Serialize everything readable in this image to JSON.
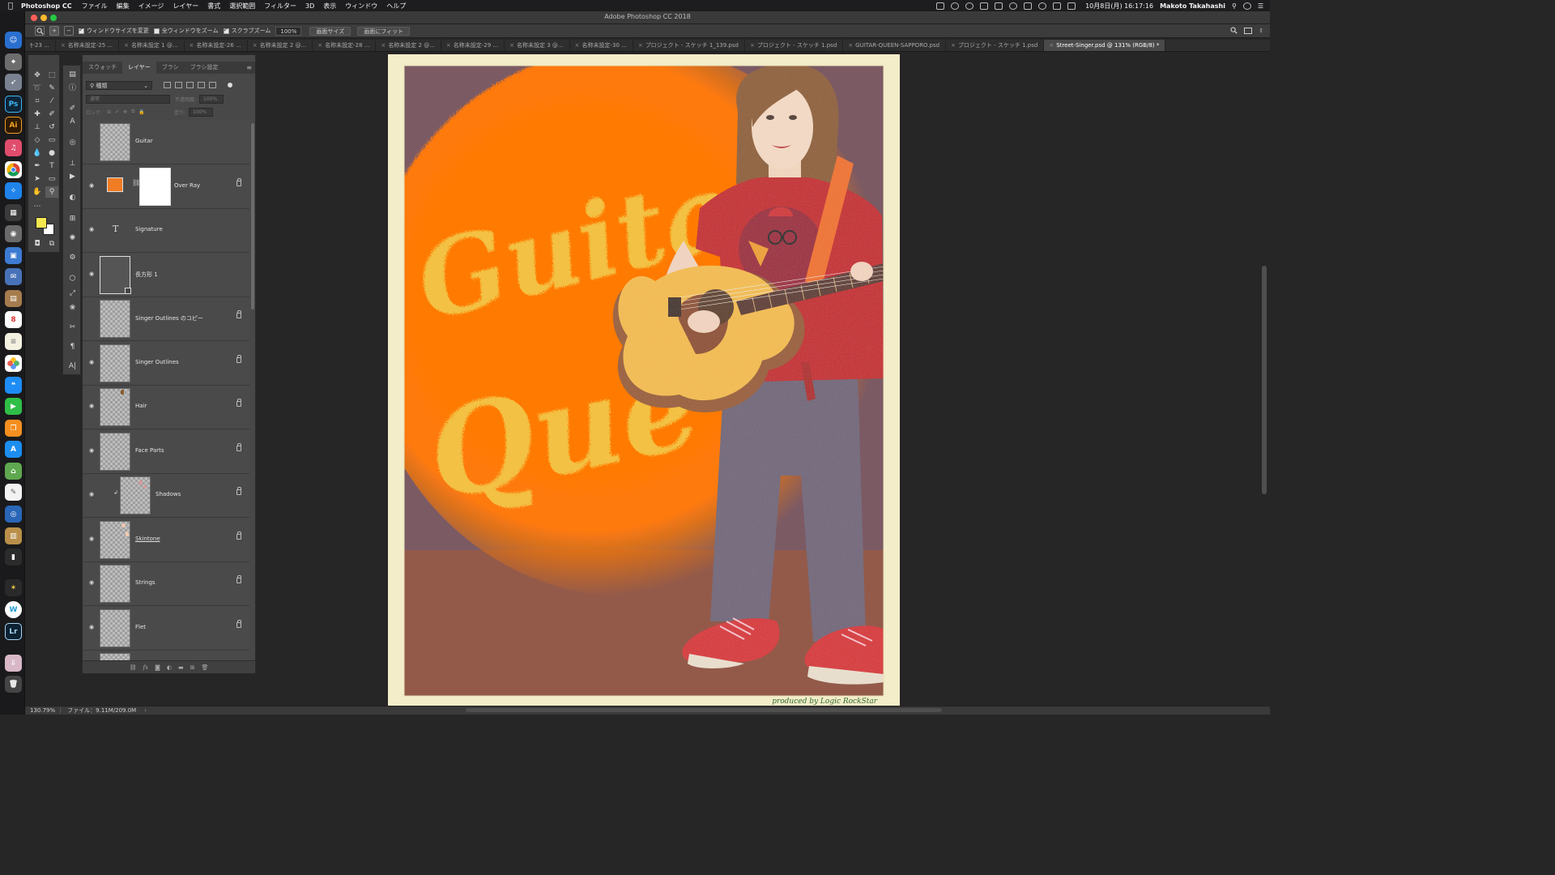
{
  "menubar": {
    "app": "Photoshop CC",
    "menus": [
      "ファイル",
      "編集",
      "イメージ",
      "レイヤー",
      "書式",
      "選択範囲",
      "フィルター",
      "3D",
      "表示",
      "ウィンドウ",
      "ヘルプ"
    ],
    "clock": "10月8日(月)  16:17:16",
    "user": "Makoto Takahashi"
  },
  "titlebar": {
    "title": "Adobe Photoshop CC 2018"
  },
  "options": {
    "resize_windows": "ウィンドウサイズを変更",
    "zoom_all": "全ウィンドウをズーム",
    "scrubby": "スクラブズーム",
    "zoom_value": "100%",
    "fit_screen": "画面サイズ",
    "fill_screen": "画面にフィット"
  },
  "tabs": [
    "ｾ-23 ...",
    "名称未設定-25 ...",
    "名称未設定 1 @...",
    "名称未設定-26 ...",
    "名称未設定 2 @...",
    "名称未設定-28 ...",
    "名称未設定 2 @...",
    "名称未設定-29 ...",
    "名称未設定 3 @...",
    "名称未設定-30 ...",
    "プロジェクト - スケッチ 1_139.psd",
    "プロジェクト - スケッチ 1.psd",
    "GUITAR-QUEEN-SAPPORO.psd",
    "プロジェクト - スケッチ 1.psd",
    "Street-Singer.psd @ 131% (RGB/8) *"
  ],
  "layers_panel": {
    "tabs": [
      "スウォッチ",
      "レイヤー",
      "ブラシ",
      "ブラシ設定"
    ],
    "filter_kind": "種類",
    "blend_mode": "通常",
    "opacity_label": "不透明度:",
    "opacity_value": "100%",
    "lock_label": "ロック:",
    "fill_label": "塗り:",
    "fill_value": "100%",
    "layers": [
      {
        "name": "Guitar",
        "visible": false,
        "locked": false
      },
      {
        "name": "Over Ray",
        "visible": true,
        "locked": true
      },
      {
        "name": "Signature",
        "visible": true,
        "locked": false
      },
      {
        "name": "長方形 1",
        "visible": true,
        "locked": false
      },
      {
        "name": "Singer Outlines のコピー",
        "visible": false,
        "locked": true
      },
      {
        "name": "Singer Outlines",
        "visible": true,
        "locked": true
      },
      {
        "name": "Hair",
        "visible": true,
        "locked": true
      },
      {
        "name": "Face Parts",
        "visible": true,
        "locked": true
      },
      {
        "name": "Shadows",
        "visible": true,
        "locked": true
      },
      {
        "name": "Skintone",
        "visible": true,
        "locked": true
      },
      {
        "name": "Strings",
        "visible": true,
        "locked": true
      },
      {
        "name": "Flet",
        "visible": true,
        "locked": true
      }
    ]
  },
  "artwork": {
    "signature": "produced by  Logic RockStar",
    "colors": {
      "mat": "#f3edc9",
      "wall": "#7b5a64",
      "glow": "#ff7a06",
      "floor": "#935a4a",
      "shirt": "#c6121a",
      "pants": "#6f6478",
      "shoes": "#d9282c"
    }
  },
  "status": {
    "zoom": "130.79%",
    "file": "ファイル：9.11M/209.0M"
  }
}
